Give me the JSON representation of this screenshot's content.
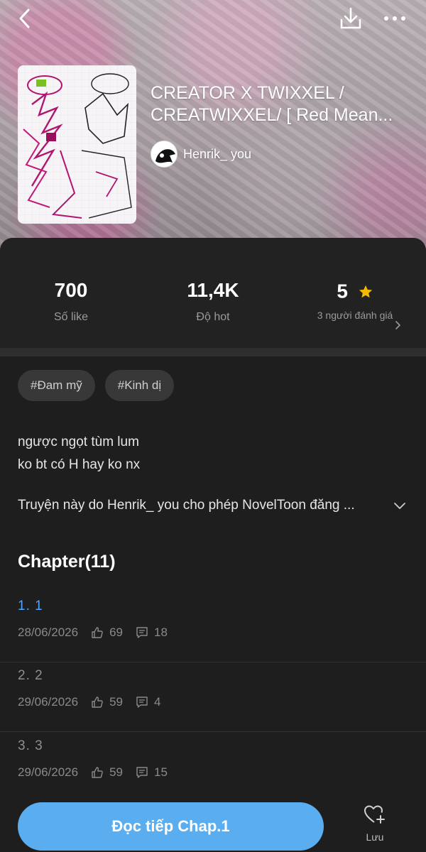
{
  "book": {
    "title": "CREATOR X TWIXXEL / CREATWIXXEL/ [ Red Meaning ... ]",
    "title_display": "CREATOR X TWIXXEL / CREATWIXXEL/ [ Red Mean...",
    "author": "Henrik_ you"
  },
  "top_bar": {
    "back_icon": "chevron-left-icon",
    "download_icon": "download-icon",
    "more_icon": "more-horizontal-icon"
  },
  "stats": {
    "likes_value": "700",
    "likes_label": "Số like",
    "hot_value": "11,4K",
    "hot_label": "Độ hot",
    "rating_value": "5",
    "rating_label": "3 người đánh giá"
  },
  "tags": [
    "#Đam mỹ",
    "#Kinh dị"
  ],
  "description": {
    "line1": "ngược ngọt tùm lum",
    "line2": "ko bt có H hay ko nx",
    "permission": "Truyện này do Henrik_ you cho phép NovelToon đăng ..."
  },
  "chapters": {
    "heading": "Chapter(11)",
    "items": [
      {
        "name": "1. 1",
        "date": "28/06/2026",
        "likes": "69",
        "comments": "18"
      },
      {
        "name": "2. 2",
        "date": "29/06/2026",
        "likes": "59",
        "comments": "4"
      },
      {
        "name": "3. 3",
        "date": "29/06/2026",
        "likes": "59",
        "comments": "15"
      }
    ]
  },
  "bottom": {
    "continue_label": "Đọc tiếp Chap.1",
    "save_label": "Lưu"
  },
  "colors": {
    "accent": "#5aaef0",
    "current_chapter": "#4ea6ff",
    "star": "#f5b800",
    "background": "#1e1e1e"
  }
}
